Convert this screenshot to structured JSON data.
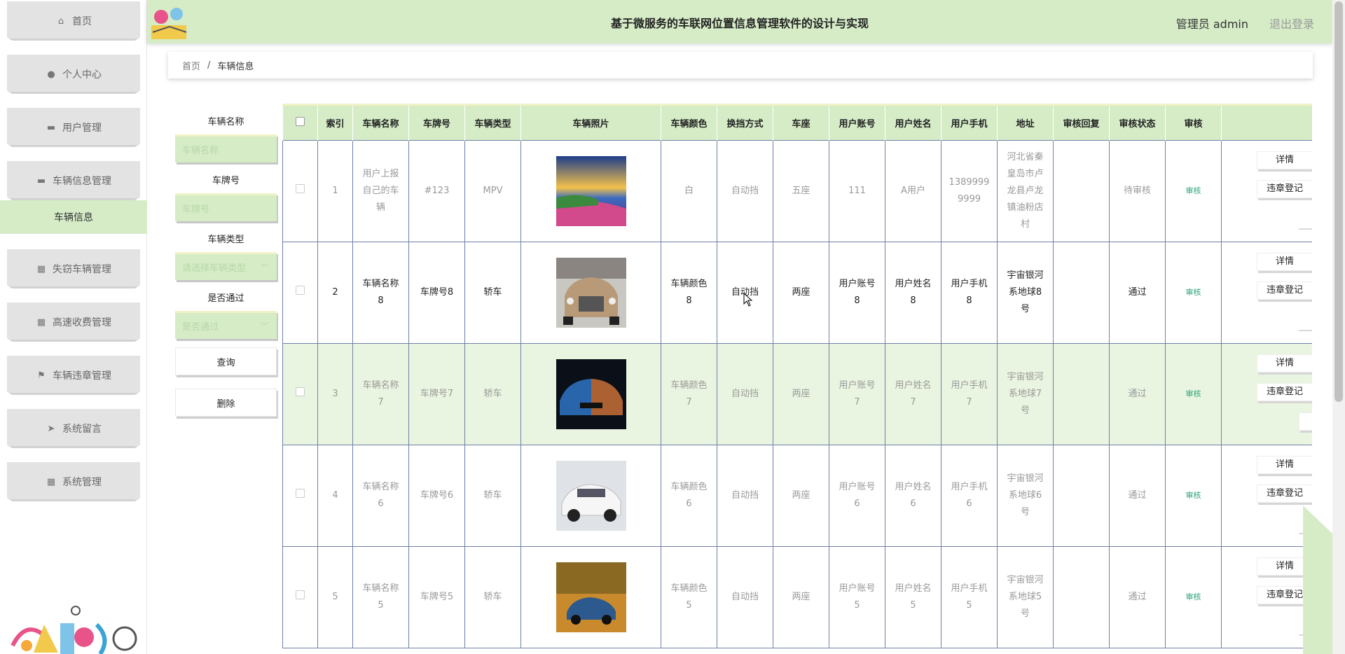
{
  "app": {
    "title": "基于微服务的车联网位置信息管理软件的设计与实现",
    "user_label": "管理员 admin",
    "logout_label": "退出登录"
  },
  "sidebar": {
    "items": [
      {
        "label": "首页",
        "icon": "home-icon"
      },
      {
        "label": "个人中心",
        "icon": "user-icon"
      },
      {
        "label": "用户管理",
        "icon": "briefcase-icon"
      },
      {
        "label": "车辆信息管理",
        "icon": "car-icon"
      },
      {
        "label": "失窃车辆管理",
        "icon": "grid-icon"
      },
      {
        "label": "高速收费管理",
        "icon": "grid-icon"
      },
      {
        "label": "车辆违章管理",
        "icon": "flag-icon"
      },
      {
        "label": "系统留言",
        "icon": "send-icon"
      },
      {
        "label": "系统管理",
        "icon": "grid-icon"
      }
    ],
    "active_sub": "车辆信息"
  },
  "breadcrumb": {
    "home": "首页",
    "separator": "/",
    "current": "车辆信息"
  },
  "search": {
    "name_label": "车辆名称",
    "name_placeholder": "车辆名称",
    "plate_label": "车牌号",
    "plate_placeholder": "车牌号",
    "type_label": "车辆类型",
    "type_placeholder": "请选择车辆类型",
    "pass_label": "是否通过",
    "pass_placeholder": "是否通过",
    "query_button": "查询",
    "delete_button": "删除"
  },
  "table": {
    "columns": [
      "索引",
      "车辆名称",
      "车牌号",
      "车辆类型",
      "车辆照片",
      "车辆颜色",
      "换挡方式",
      "车座",
      "用户账号",
      "用户姓名",
      "用户手机",
      "地址",
      "审核回复",
      "审核状态",
      "审核"
    ],
    "rows": [
      {
        "index": "1",
        "name": "用户上报自己的车辆",
        "plate": "#123",
        "type": "MPV",
        "color": "白",
        "gear": "自动挡",
        "seats": "五座",
        "account": "111",
        "username": "A用户",
        "phone": "13899999999",
        "address": "河北省秦皇岛市卢龙县卢龙镇油粉店村",
        "reply": "",
        "status": "待审核",
        "audit": "审核",
        "photo": "landscape"
      },
      {
        "index": "2",
        "name": "车辆名称8",
        "plate": "车牌号8",
        "type": "轿车",
        "color": "车辆颜色8",
        "gear": "自动挡",
        "seats": "两座",
        "account": "用户账号8",
        "username": "用户姓名8",
        "phone": "用户手机8",
        "address": "宇宙银河系地球8号",
        "reply": "",
        "status": "通过",
        "audit": "审核",
        "photo": "suv"
      },
      {
        "index": "3",
        "name": "车辆名称7",
        "plate": "车牌号7",
        "type": "轿车",
        "color": "车辆颜色7",
        "gear": "自动挡",
        "seats": "两座",
        "account": "用户账号7",
        "username": "用户姓名7",
        "phone": "用户手机7",
        "address": "宇宙银河系地球7号",
        "reply": "",
        "status": "通过",
        "audit": "审核",
        "photo": "sportscar"
      },
      {
        "index": "4",
        "name": "车辆名称6",
        "plate": "车牌号6",
        "type": "轿车",
        "color": "车辆颜色6",
        "gear": "自动挡",
        "seats": "两座",
        "account": "用户账号6",
        "username": "用户姓名6",
        "phone": "用户手机6",
        "address": "宇宙银河系地球6号",
        "reply": "",
        "status": "通过",
        "audit": "审核",
        "photo": "whitecar"
      },
      {
        "index": "5",
        "name": "车辆名称5",
        "plate": "车牌号5",
        "type": "轿车",
        "color": "车辆颜色5",
        "gear": "自动挡",
        "seats": "两座",
        "account": "用户账号5",
        "username": "用户姓名5",
        "phone": "用户手机5",
        "address": "宇宙银河系地球5号",
        "reply": "",
        "status": "通过",
        "audit": "审核",
        "photo": "autumn"
      }
    ],
    "row_actions": {
      "detail": "详情",
      "violation": "违章登记"
    }
  },
  "colors": {
    "accent": "#d5ecc7",
    "accent_light": "#eaf5e1",
    "audit_link": "#2aa37a",
    "border": "#6f7fa8"
  }
}
